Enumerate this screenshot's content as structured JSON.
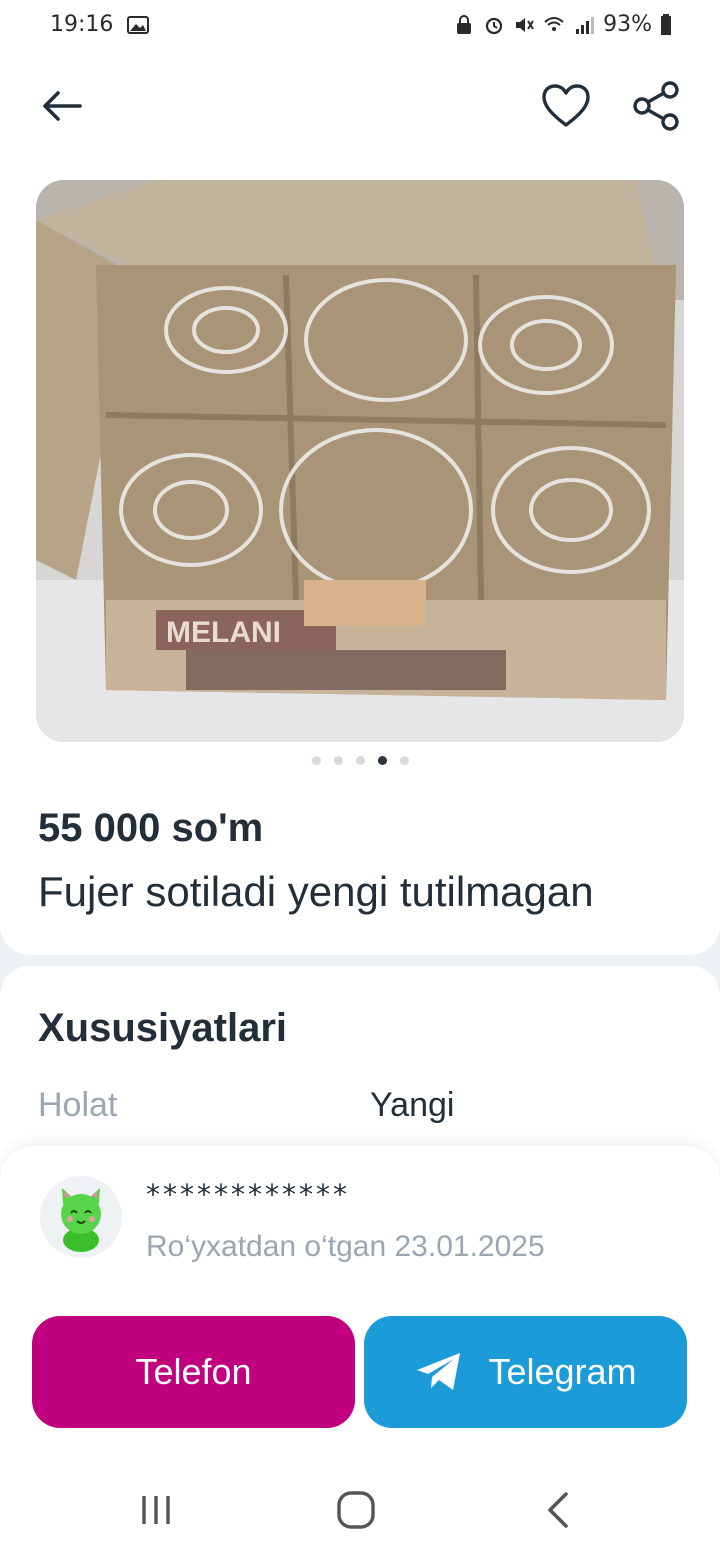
{
  "status_bar": {
    "time": "19:16",
    "battery": "93%"
  },
  "header": {
    "back_icon": "arrow-left-icon",
    "favorite_icon": "heart-icon",
    "share_icon": "share-icon"
  },
  "gallery": {
    "image_alt": "Box of six glass tumblers",
    "box_brand": "MELANI",
    "slide_count": 5,
    "active_slide": 4
  },
  "listing": {
    "price": "55 000 so'm",
    "title": "Fujer sotiladi yengi tutilmagan"
  },
  "specs": {
    "heading": "Xususiyatlari",
    "rows": [
      {
        "key": "Holat",
        "value": "Yangi"
      }
    ]
  },
  "seller": {
    "name": "************",
    "registered": "Ro‘yxatdan o‘tgan 23.01.2025"
  },
  "actions": {
    "phone_label": "Telefon",
    "telegram_label": "Telegram"
  },
  "colors": {
    "phone_button": "#c0007f",
    "telegram_button": "#1b9bd8",
    "text_primary": "#222f3a",
    "text_secondary": "#9aa6b2"
  }
}
